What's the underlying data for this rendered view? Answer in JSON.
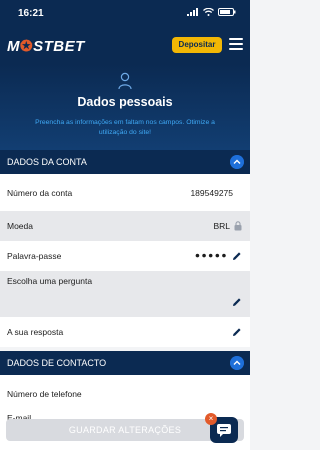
{
  "status": {
    "time": "16:21"
  },
  "header": {
    "logo_left": "M",
    "logo_right": "STBET",
    "deposit_label": "Depositar"
  },
  "hero": {
    "title": "Dados pessoais",
    "subtitle": "Preencha as informações em faltam nos campos. Otimize a utilização do site!"
  },
  "sections": {
    "account": {
      "title": "DADOS DA CONTA"
    },
    "contact": {
      "title": "DADOS DE CONTACTO"
    }
  },
  "account_fields": {
    "account_number": {
      "label": "Número da conta",
      "value": "189549275"
    },
    "currency": {
      "label": "Moeda",
      "value": "BRL"
    },
    "password": {
      "label": "Palavra-passe",
      "value": "●●●●●"
    },
    "question": {
      "label": "Escolha uma pergunta"
    },
    "answer": {
      "label": "A sua resposta"
    }
  },
  "contact_fields": {
    "phone": {
      "label": "Número de telefone"
    },
    "email": {
      "label": "E-mail"
    }
  },
  "actions": {
    "save_label": "GUARDAR ALTERAÇÕES",
    "chat_badge": "×"
  },
  "colors": {
    "navy": "#0b2a52",
    "accent_blue": "#1e6fd9",
    "deposit_yellow": "#f2b705",
    "orange": "#e25a2a"
  }
}
